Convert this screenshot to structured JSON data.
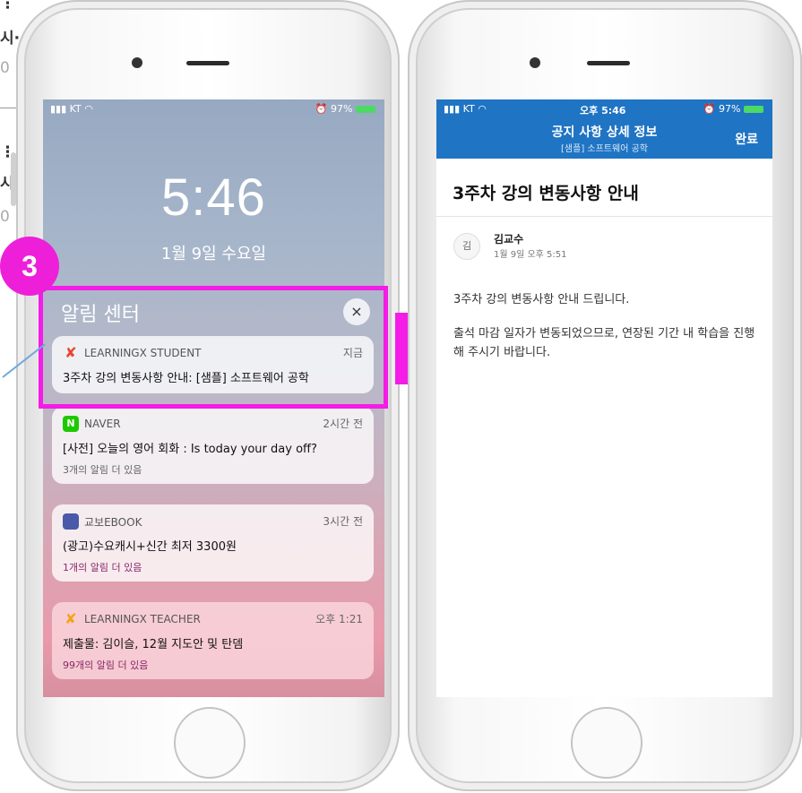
{
  "background": {
    "fragments": [
      "⋮",
      "시·",
      "0",
      "⋮",
      "시",
      "0"
    ]
  },
  "left_phone": {
    "status": {
      "carrier": "KT",
      "battery": "97%"
    },
    "time": "5:46",
    "date": "1월 9일 수요일",
    "notification_center": {
      "title": "알림 센터",
      "close": "×"
    },
    "notifications": [
      {
        "app": "LEARNINGX STUDENT",
        "when": "지금",
        "message": "3주차 강의 변동사항 안내: [샘플] 소프트웨어 공학",
        "more": ""
      },
      {
        "app": "NAVER",
        "icon_letter": "N",
        "when": "2시간 전",
        "message": "[사전] 오늘의 영어 회화 : Is today your day off?",
        "more": "3개의 알림 더 있음"
      },
      {
        "app": "교보EBOOK",
        "when": "3시간 전",
        "message": "(광고)수요캐시+신간 최저 3300원",
        "more": "1개의 알림 더 있음"
      },
      {
        "app": "LEARNINGX TEACHER",
        "when": "오후 1:21",
        "message": "제출물: 김이슬, 12월 지도안 및 탄뎀",
        "more": "99개의 알림 더 있음"
      }
    ]
  },
  "annotation": {
    "step": "3",
    "color": "#f41ce6"
  },
  "right_phone": {
    "status": {
      "carrier": "KT",
      "time": "오후 5:46",
      "battery": "97%"
    },
    "header": {
      "title": "공지 사항 상세 정보",
      "subtitle": "[샘플] 소프트웨어 공학",
      "done": "완료"
    },
    "notice": {
      "title": "3주차 강의 변동사항 안내",
      "author_initial": "김",
      "author": "김교수",
      "posted": "1월 9일 오후 5:51",
      "body1": "3주차 강의 변동사항 안내 드립니다.",
      "body2": "출석 마감 일자가 변동되었으므로, 연장된 기간 내 학습을 진행해 주시기 바랍니다."
    },
    "accent": "#1f74c4"
  }
}
